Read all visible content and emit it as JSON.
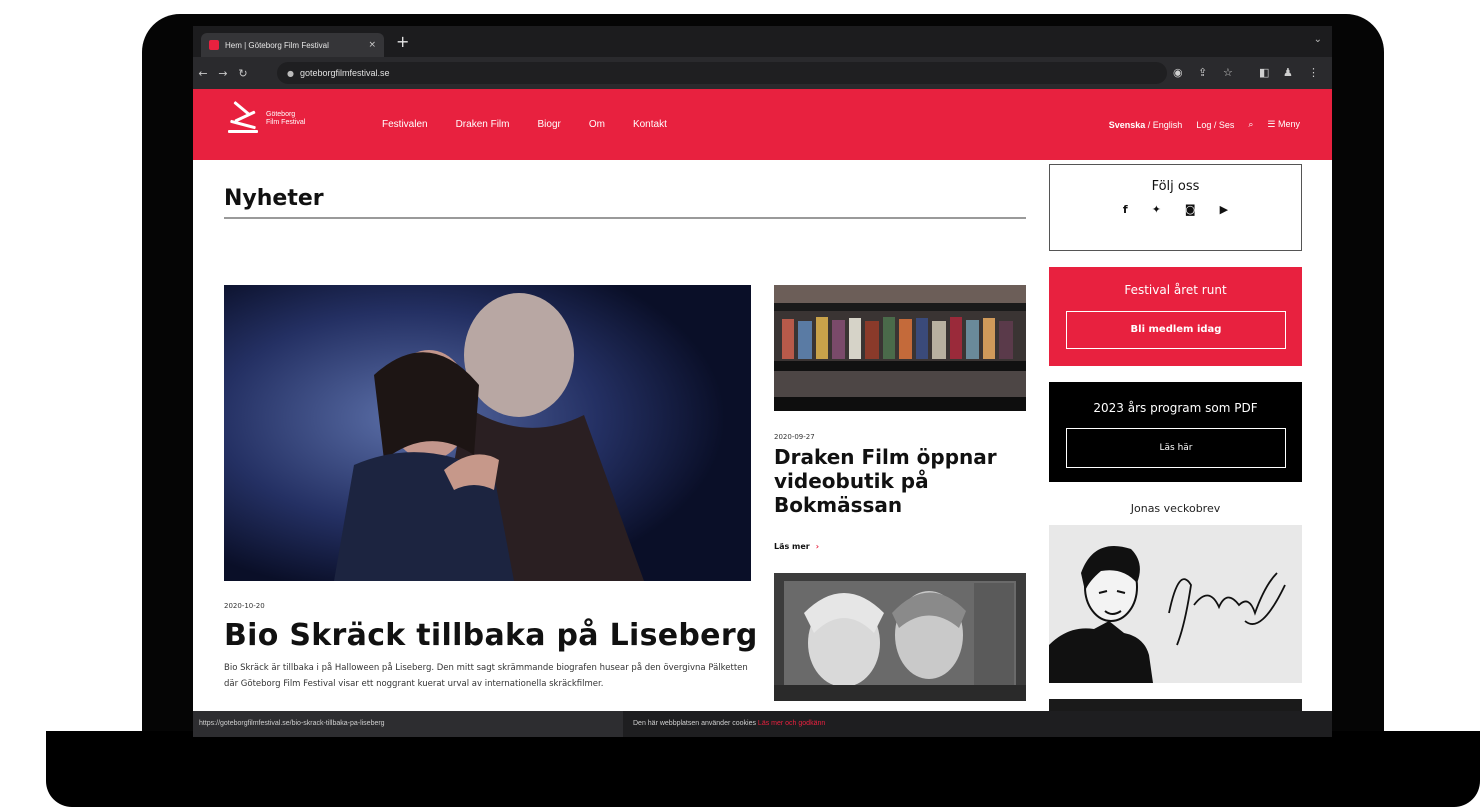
{
  "browser": {
    "tab_title": "Hem | Göteborg Film Festival",
    "tab_close": "×",
    "new_tab": "+",
    "url": "goteborgfilmfestival.se",
    "status_url": "https://goteborgfilmfestival.se/bio-skrack-tillbaka-pa-liseberg"
  },
  "header": {
    "logo_text_1": "Göteborg",
    "logo_text_2": "Film Festival",
    "nav": [
      "Festivalen",
      "Draken Film",
      "Biogr",
      "Om",
      "Kontakt"
    ],
    "lang_active": "Svenska",
    "lang_sep": "/",
    "lang_other": "English",
    "login": "Log / Ses",
    "menu": "Meny",
    "accent": "#e8213f"
  },
  "main": {
    "page_title": "Nyheter",
    "hero": {
      "date": "2020-10-20",
      "title": "Bio Skräck tillbaka på Liseberg",
      "excerpt": "Bio Skräck är tillbaka i på Halloween på Liseberg. Den mitt sagt skrämmande biografen husear på den övergivna Pälketten där Göteborg Film Festival visar ett noggrant kuerat urval av internationella skräckfilmer."
    },
    "side_article": {
      "date": "2020-09-27",
      "title": "Draken Film öppnar videobutik på Bokmässan",
      "more": "Läs mer",
      "more_arrow": "›"
    }
  },
  "sidebar": {
    "follow_title": "Följ oss",
    "social": [
      {
        "icon": "facebook-icon",
        "glyph": "f"
      },
      {
        "icon": "twitter-icon",
        "glyph": "✦"
      },
      {
        "icon": "instagram-icon",
        "glyph": "◙"
      },
      {
        "icon": "youtube-icon",
        "glyph": "▶"
      }
    ],
    "festival_title": "Festival året runt",
    "festival_button": "Bli medlem idag",
    "program_title": "2023 års program som PDF",
    "program_button": "Läs här",
    "newsletter_title": "Jonas veckobrev"
  },
  "cookie": {
    "text": "Den här webbplatsen använder cookies",
    "link": "Läs mer och godkänn"
  }
}
